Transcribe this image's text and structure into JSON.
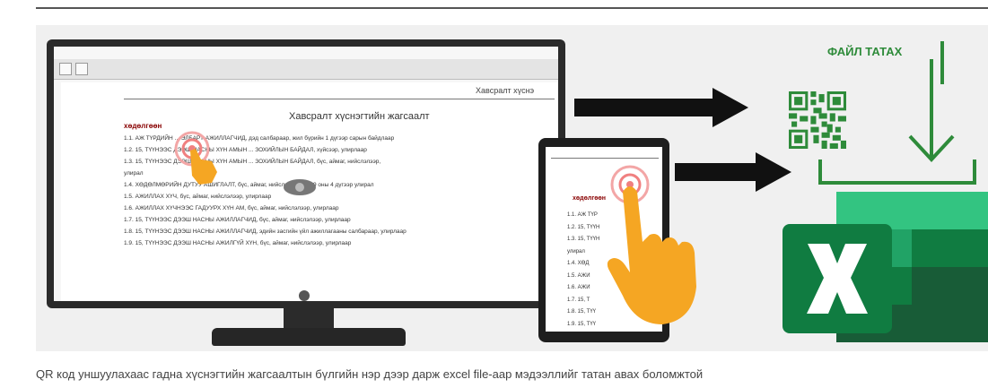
{
  "monitor": {
    "document": {
      "header": "Хавсралт хүснэ",
      "title": "Хавсралт хүснэгтийн жагсаалт",
      "section": "хөдөлгөөн",
      "lines": [
        "1.1. АЖ ТҮРДИЙН ... ЭЛБАРТ АЖИЛЛАГЧИД, дэд салбараар, жил бүрийн 1 дүгээр сарын байдлаар",
        "1.2. 15, ТҮҮНЭЭС ДЭЭШ НАСНЫ ХҮН АМЫН ... ЗОХИЙЛЫН БАЙДАЛ, хүйсээр, улирлаар",
        "1.3. 15, ТҮҮНЭЭС ДЭЭШ НАСНЫ ХҮН АМЫН ... ЗОХИЙЛЫН БАЙДАЛ, бүс, аймаг, нийслэлээр,",
        "улирал",
        "1.4. ХӨДӨЛМӨРИЙН ДУТУУ АШИГЛАЛТ, бүс, аймаг, нийслэлээр, 2019 оны 4 дүгээр улирал",
        "1.5. АЖИЛЛАХ ХҮЧ, бүс, аймаг, нийслэлээр, улирлаар",
        "1.6. АЖИЛЛАХ ХҮЧНЭЭС ГАДУУРХ ХҮН АМ, бүс, аймаг, нийслэлээр, улирлаар",
        "1.7. 15, ТҮҮНЭЭС ДЭЭШ НАСНЫ АЖИЛЛАГЧИД, бүс, аймаг, нийслэлээр, улирлаар",
        "1.8. 15, ТҮҮНЭЭС ДЭЭШ НАСНЫ АЖИЛЛАГЧИД, эдийн засгийн үйл ажиллагааны салбараар, улирлаар",
        "1.9. 15, ТҮҮНЭЭС ДЭЭШ НАСНЫ АЖИЛГҮЙ ХҮН, бүс, аймаг, нийслэлээр, улирлаар"
      ]
    }
  },
  "tablet": {
    "section": "хөдөлгөөн",
    "lines": [
      "1.1. АЖ ТҮР",
      "1.2. 15, ТҮҮН",
      "1.3. 15, ТҮҮН",
      "улирал",
      "1.4. ХӨД",
      "1.5. АЖИ",
      "1.6. АЖИ",
      "1.7. 15, Т",
      "1.8. 15, ТҮҮ",
      "1.9. 15, ТҮҮ"
    ]
  },
  "download": {
    "label": "ФАЙЛ ТАТАХ"
  },
  "colors": {
    "accent_green": "#2e8b3a",
    "excel_green": "#107c41",
    "touch_orange": "#f5a623"
  },
  "icons": [
    "qr-code-icon",
    "download-icon",
    "excel-icon",
    "hand-pointer-icon",
    "eye-icon"
  ],
  "caption": "QR код уншуулахаас гадна хүснэгтийн жагсаалтын бүлгийн нэр дээр дарж excel file-аар мэдээллийг татан авах боломжтой"
}
